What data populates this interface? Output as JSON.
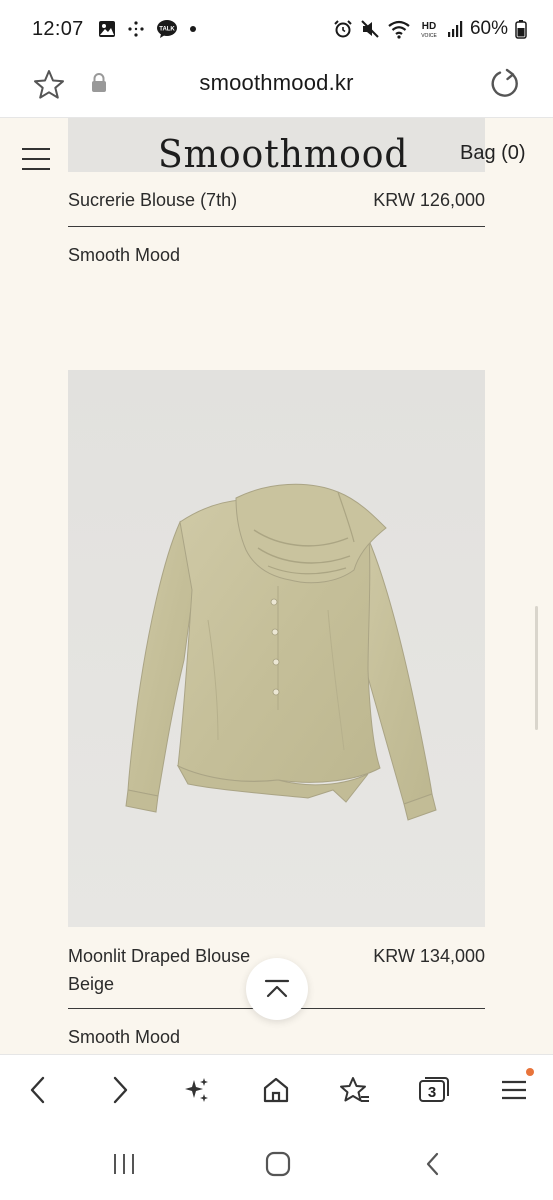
{
  "status_bar": {
    "time": "12:07",
    "left_icons": [
      "gallery-icon",
      "sparkle-dots-icon",
      "talk-icon",
      "dot-icon"
    ],
    "talk_badge": "TALK",
    "right_icons": [
      "alarm-icon",
      "mute-icon",
      "wifi-icon",
      "hd-voice-icon",
      "signal-icon",
      "battery-icon"
    ],
    "hd_label": "HD",
    "voice_label": "VOICE",
    "battery_percent": "60%"
  },
  "browser": {
    "url": "smoothmood.kr",
    "tabs_count": "3"
  },
  "site": {
    "logo": "Smoothmood",
    "bag_label": "Bag (0)"
  },
  "products": [
    {
      "name": "Sucrerie Blouse (7th)",
      "price": "KRW 126,000",
      "brand": "Smooth Mood"
    },
    {
      "name": "Moonlit Draped Blouse",
      "variant": "Beige",
      "price": "KRW 134,000",
      "brand": "Smooth Mood"
    }
  ],
  "colors": {
    "page_background": "#faf6ee",
    "image_background": "#e5e4e1",
    "blouse_color": "#c9c39e",
    "notification_dot": "#e8743b"
  }
}
